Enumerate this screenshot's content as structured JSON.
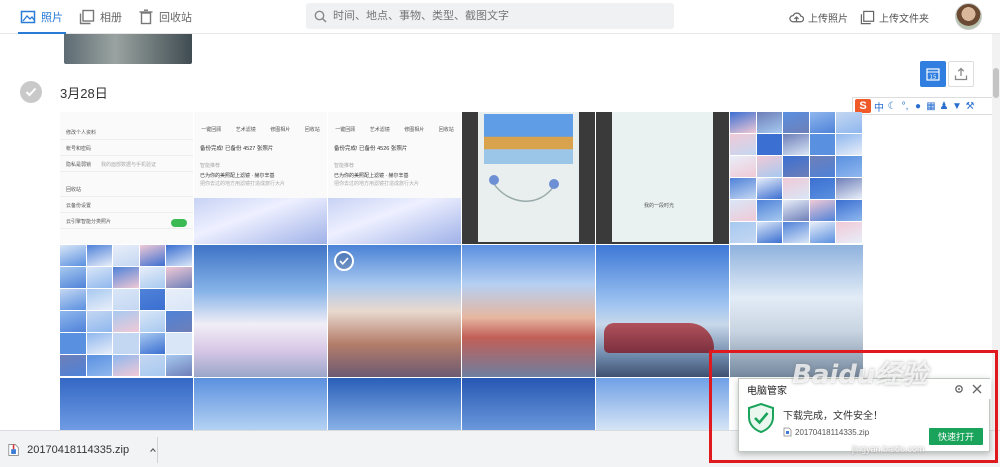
{
  "nav": {
    "photos": "照片",
    "albums": "相册",
    "trash": "回收站"
  },
  "search": {
    "placeholder": "时间、地点、事物、类型、截图文字"
  },
  "actions": {
    "upload_photo": "上传照片",
    "upload_folder": "上传文件夹"
  },
  "section": {
    "date": "3月28日"
  },
  "toolbar": {
    "calendar_day": "15"
  },
  "ime": {
    "lang": "中"
  },
  "phone_left": {
    "rows": [
      "修改个人资料",
      "帐号和密码",
      "隐私是弱锁",
      "回收站",
      "云备份设置",
      "云引擎智能分类照片"
    ],
    "lock_hint": "我的面部数据与手机验证"
  },
  "phone_mid1": {
    "tabs": [
      "一键回顾",
      "艺术滤镜",
      "修图相片",
      "回收站"
    ],
    "backup": "备份完成! 已备份 4527 张照片",
    "section": "智能推荐",
    "feature": "已为你的美照配上滤镜 · 赫尔辛基",
    "feature_sub": "把你去过的地方用滤镜打造成旅行大片"
  },
  "phone_mid2": {
    "tabs": [
      "一键回顾",
      "艺术滤镜",
      "修图相片",
      "回收站"
    ],
    "backup": "备份完成! 已备份 4526 张照片",
    "section": "智能推荐",
    "feature": "已为你的美照配上滤镜 · 赫尔辛基",
    "feature_sub": "把你去过的地方用滤镜打造成旅行大片"
  },
  "phone_map": {
    "caption": "我的一段时光"
  },
  "download": {
    "filename": "20170418114335.zip"
  },
  "notify": {
    "title": "电脑管家",
    "message": "下载完成，文件安全！",
    "file": "20170418114335.zip",
    "open": "快速打开"
  },
  "watermark": {
    "brand": "Baidu经验",
    "url": "jingyan.baidu.com"
  },
  "colors": {
    "accent": "#2a7bd6",
    "green": "#1aa35a",
    "red_box": "#e0191e"
  }
}
